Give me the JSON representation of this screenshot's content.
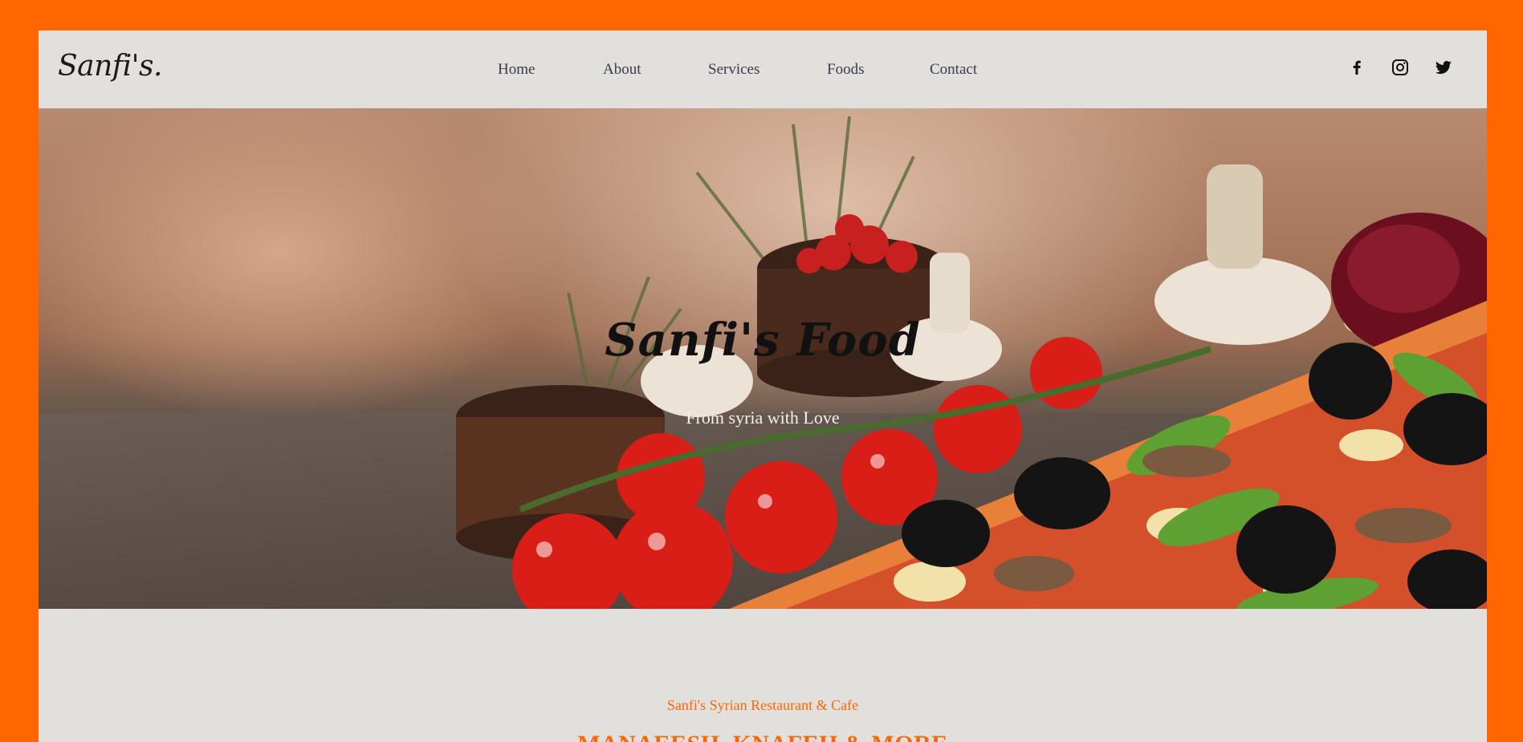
{
  "brand": {
    "logo_text": "Sanfi's."
  },
  "nav": {
    "items": [
      {
        "label": "Home"
      },
      {
        "label": "About"
      },
      {
        "label": "Services"
      },
      {
        "label": "Foods"
      },
      {
        "label": "Contact"
      }
    ]
  },
  "social": {
    "icons": [
      "facebook-icon",
      "instagram-icon",
      "twitter-icon"
    ]
  },
  "hero": {
    "title": "Sanfi's Food",
    "subtitle": "From syria with Love"
  },
  "intro": {
    "eyebrow": "Sanfi's Syrian Restaurant & Cafe",
    "headline": "MANAEESH, KNAFEH & MORE"
  },
  "colors": {
    "accent": "#ff6600",
    "panel": "#e1e0dc",
    "nav_text": "#3a3a4a"
  }
}
